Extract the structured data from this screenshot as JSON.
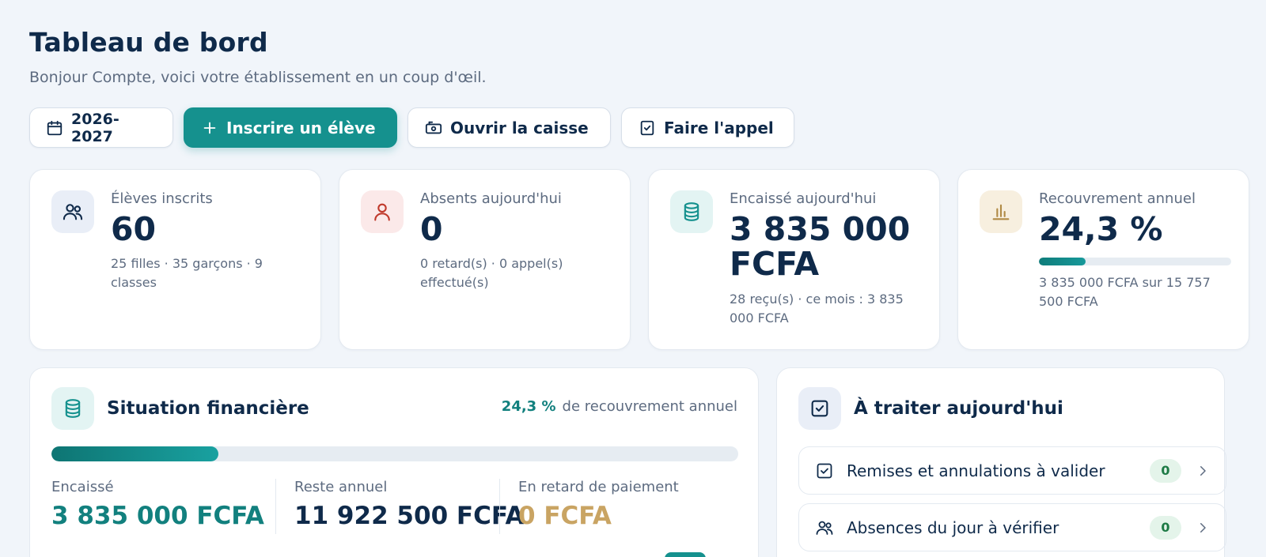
{
  "header": {
    "title": "Tableau de bord",
    "subtitle": "Bonjour Compte, voici votre établissement en un coup d'œil."
  },
  "toolbar": {
    "year_label": "2026-2027",
    "enroll_label": "Inscrire un élève",
    "cash_label": "Ouvrir la caisse",
    "attendance_label": "Faire l'appel",
    "icons": [
      "calendar-icon",
      "plus-icon",
      "cash-register-icon",
      "checkbox-icon"
    ]
  },
  "stats": {
    "students": {
      "label": "Élèves inscrits",
      "value": "60",
      "sub": "25 filles · 35 garçons · 9 classes",
      "icon": "users-icon"
    },
    "absents": {
      "label": "Absents aujourd'hui",
      "value": "0",
      "sub": "0 retard(s) · 0 appel(s) effectué(s)",
      "icon": "user-icon"
    },
    "collected": {
      "label": "Encaissé aujourd'hui",
      "value": "3 835 000 FCFA",
      "sub": "28 reçu(s) · ce mois : 3 835 000 FCFA",
      "icon": "database-icon"
    },
    "recovery": {
      "label": "Recouvrement annuel",
      "value": "24,3 %",
      "progress": 0.243,
      "sub": "3 835 000 FCFA sur 15 757 500 FCFA",
      "icon": "bar-chart-icon"
    }
  },
  "finance": {
    "title": "Situation financière",
    "recovery_pct": "24,3 %",
    "recovery_text": "de recouvrement annuel",
    "progress": 0.243,
    "collected_label": "Encaissé",
    "collected_value": "3 835 000 FCFA",
    "remaining_label": "Reste annuel",
    "remaining_value": "11 922 500 FCFA",
    "late_label": "En retard de paiement",
    "late_value": "0 FCFA"
  },
  "todo": {
    "title": "À traiter aujourd'hui",
    "items": [
      {
        "label": "Remises et annulations à valider",
        "count": "0",
        "icon": "checkbox-icon"
      },
      {
        "label": "Absences du jour à vérifier",
        "count": "0",
        "icon": "users-icon"
      }
    ]
  },
  "colors": {
    "primary": "#15918e",
    "navy": "#0f2a4a",
    "muted": "#5d6b80",
    "gold": "#c9a463",
    "danger": "#c0392b"
  }
}
